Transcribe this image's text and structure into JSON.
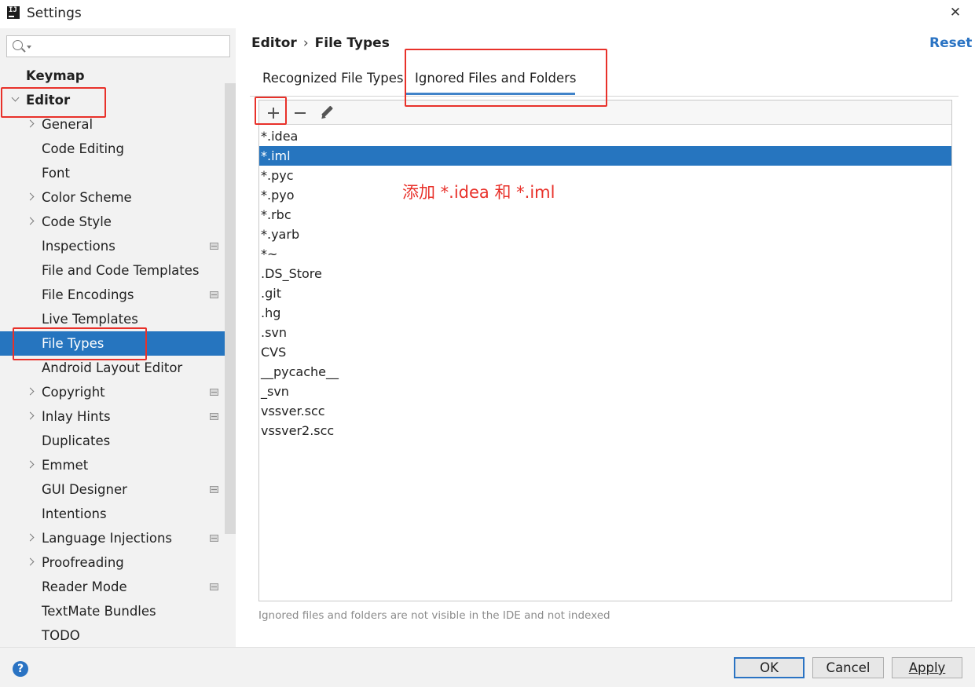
{
  "window": {
    "title": "Settings",
    "app_icon": "IJ",
    "close_glyph": "✕"
  },
  "sidebar": {
    "search": {
      "placeholder": "",
      "value": ""
    },
    "items": [
      {
        "label": "Keymap",
        "level": 0,
        "bold": true
      },
      {
        "label": "Editor",
        "level": 0,
        "bold": true,
        "expanded": true
      },
      {
        "label": "General",
        "level": 1,
        "expandable": true
      },
      {
        "label": "Code Editing",
        "level": 1
      },
      {
        "label": "Font",
        "level": 1
      },
      {
        "label": "Color Scheme",
        "level": 1,
        "expandable": true
      },
      {
        "label": "Code Style",
        "level": 1,
        "expandable": true
      },
      {
        "label": "Inspections",
        "level": 1,
        "project_icon": true
      },
      {
        "label": "File and Code Templates",
        "level": 1
      },
      {
        "label": "File Encodings",
        "level": 1,
        "project_icon": true
      },
      {
        "label": "Live Templates",
        "level": 1
      },
      {
        "label": "File Types",
        "level": 1,
        "selected": true
      },
      {
        "label": "Android Layout Editor",
        "level": 1
      },
      {
        "label": "Copyright",
        "level": 1,
        "expandable": true,
        "project_icon": true
      },
      {
        "label": "Inlay Hints",
        "level": 1,
        "expandable": true,
        "project_icon": true
      },
      {
        "label": "Duplicates",
        "level": 1
      },
      {
        "label": "Emmet",
        "level": 1,
        "expandable": true
      },
      {
        "label": "GUI Designer",
        "level": 1,
        "project_icon": true
      },
      {
        "label": "Intentions",
        "level": 1
      },
      {
        "label": "Language Injections",
        "level": 1,
        "expandable": true,
        "project_icon": true
      },
      {
        "label": "Proofreading",
        "level": 1,
        "expandable": true
      },
      {
        "label": "Reader Mode",
        "level": 1,
        "project_icon": true
      },
      {
        "label": "TextMate Bundles",
        "level": 1
      },
      {
        "label": "TODO",
        "level": 1
      }
    ]
  },
  "header": {
    "breadcrumb": [
      "Editor",
      "File Types"
    ],
    "separator": "›",
    "reset_label": "Reset"
  },
  "tabs": [
    {
      "label": "Recognized File Types",
      "active": false
    },
    {
      "label": "Ignored Files and Folders",
      "active": true
    }
  ],
  "toolbar": {
    "icons": [
      "plus-icon",
      "minus-icon",
      "pencil-icon"
    ]
  },
  "ignored_list": [
    {
      "value": "*.idea"
    },
    {
      "value": "*.iml",
      "selected": true
    },
    {
      "value": "*.pyc"
    },
    {
      "value": "*.pyo"
    },
    {
      "value": "*.rbc"
    },
    {
      "value": "*.yarb"
    },
    {
      "value": "*~"
    },
    {
      "value": ".DS_Store"
    },
    {
      "value": ".git"
    },
    {
      "value": ".hg"
    },
    {
      "value": ".svn"
    },
    {
      "value": "CVS"
    },
    {
      "value": "__pycache__"
    },
    {
      "value": "_svn"
    },
    {
      "value": "vssver.scc"
    },
    {
      "value": "vssver2.scc"
    }
  ],
  "annotation": {
    "text": "添加 *.idea 和 *.iml",
    "color": "#e8312a"
  },
  "hint": "Ignored files and folders are not visible in the IDE and not indexed",
  "footer": {
    "ok_label": "OK",
    "cancel_label": "Cancel",
    "apply_label": "Apply",
    "help_glyph": "?"
  },
  "colors": {
    "selection": "#2675bf",
    "accent": "#2a73c3",
    "highlight_box": "#e8312a"
  }
}
